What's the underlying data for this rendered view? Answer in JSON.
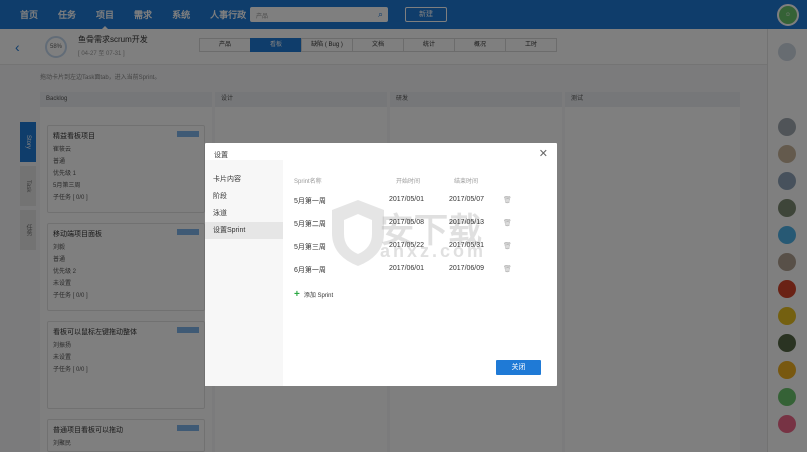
{
  "topnav": {
    "items": [
      "首页",
      "任务",
      "项目",
      "需求",
      "系统",
      "人事行政 ⌄"
    ],
    "search_placeholder": "产品",
    "new_label": "新建"
  },
  "project": {
    "progress": "58%",
    "title": "鱼骨需求scrum开发",
    "date": "[ 04-27 至 07-31 ]",
    "tabs": [
      "产品",
      "看板",
      "缺陷 ( Bug )",
      "文档",
      "统计",
      "概况",
      "工时"
    ],
    "active_tab": "看板"
  },
  "board": {
    "tip": "拖动卡片到左边Task面tab，进入当前Sprint。",
    "side_tabs": [
      "Story",
      "Task",
      "任务"
    ],
    "columns": [
      "Backlog",
      "设计",
      "研发",
      "测试"
    ],
    "cards": [
      {
        "title": "精益看板项目",
        "owner": "崔筱云",
        "priority": "普通",
        "tag": "优先级 1",
        "sprint": "5月第三周",
        "sub": "子任务 [ 0/0 ]",
        "bug": "BUG [ 0/0 ]"
      },
      {
        "title": "移动端项目面板",
        "owner": "刘毅",
        "priority": "普通",
        "tag": "优先级 2",
        "sprint": "未设置",
        "sub": "子任务 [ 0/0 ]",
        "bug": "BUG [ 0/0 ]"
      },
      {
        "title": "看板可以鼠标左键拖动整体",
        "owner": "刘振扬",
        "priority": "",
        "tag": "",
        "sprint": "未设置",
        "sub": "子任务 [ 0/0 ]",
        "bug": "BUG [ 0/0 ]"
      },
      {
        "title": "普通项目看板可以拖动",
        "owner": "刘聚民",
        "priority": "",
        "tag": "",
        "sprint": "",
        "sub": "",
        "bug": ""
      }
    ]
  },
  "dialog": {
    "title": "设置",
    "menu": [
      "卡片内容",
      "阶段",
      "泳道",
      "设置Sprint"
    ],
    "active_menu": "设置Sprint",
    "headers": [
      "Sprint名称",
      "开始时间",
      "结束时间"
    ],
    "sprints": [
      {
        "name": "5月第一周",
        "start": "2017/05/01",
        "end": "2017/05/07"
      },
      {
        "name": "5月第二周",
        "start": "2017/05/08",
        "end": "2017/05/13"
      },
      {
        "name": "5月第三周",
        "start": "2017/05/22",
        "end": "2017/05/31"
      },
      {
        "name": "6月第一周",
        "start": "2017/06/01",
        "end": "2017/06/09"
      }
    ],
    "add_label": "添加 Sprint",
    "close_label": "关闭"
  },
  "watermark": {
    "text": "安下载",
    "url": "anxz.com"
  },
  "colors": {
    "primary": "#1f7ad6",
    "add": "#2aa843"
  }
}
